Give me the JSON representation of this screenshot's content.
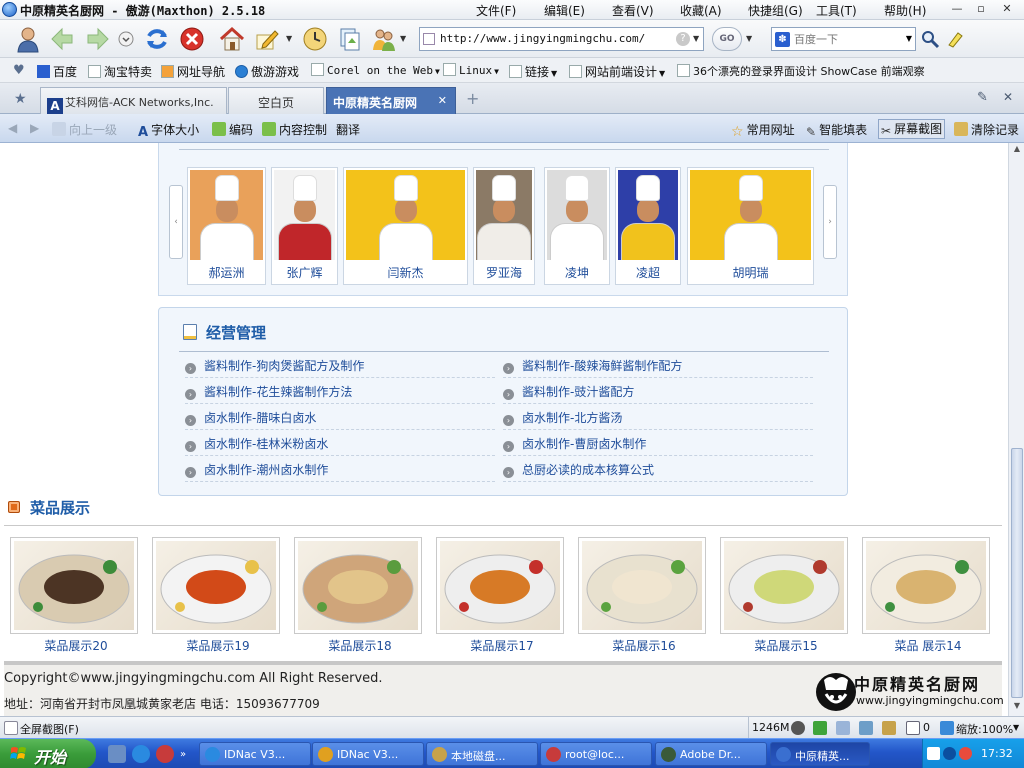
{
  "window": {
    "title": "中原精英名厨网 - 傲游(Maxthon) 2.5.18",
    "menu": [
      "文件(F)",
      "编辑(E)",
      "查看(V)",
      "收藏(A)",
      "快捷组(G)",
      "工具(T)",
      "帮助(H)"
    ]
  },
  "toolbar": {
    "address": "http://www.jingyingmingchu.com/",
    "go_label": "GO",
    "search_placeholder": "百度一下"
  },
  "favorites": [
    {
      "label": "百度",
      "dropdown": false
    },
    {
      "label": "淘宝特卖",
      "dropdown": false
    },
    {
      "label": "网址导航",
      "dropdown": false
    },
    {
      "label": "傲游游戏",
      "dropdown": false
    },
    {
      "label": "Corel on the Web",
      "dropdown": true
    },
    {
      "label": "Linux",
      "dropdown": true
    },
    {
      "label": "链接",
      "dropdown": true
    },
    {
      "label": "网站前端设计",
      "dropdown": true
    },
    {
      "label": "36个漂亮的登录界面设计 ShowCase 前端观察",
      "dropdown": false
    }
  ],
  "tabs": [
    {
      "label": "艾科网信-ACK Networks,Inc.",
      "active": false
    },
    {
      "label": "空白页",
      "active": false
    },
    {
      "label": "中原精英名厨网",
      "active": true
    }
  ],
  "subbar": {
    "up_label": "向上一级",
    "font_size": "字体大小",
    "encoding": "编码",
    "content_control": "内容控制",
    "translate": "翻译",
    "common_sites": "常用网址",
    "smart_fill": "智能填表",
    "screenshot": "屏幕截图",
    "clear_history": "清除记录"
  },
  "chefs": [
    {
      "name": "郝运洲",
      "bg": "#e9a15a",
      "body": "#ffffff"
    },
    {
      "name": "张广辉",
      "bg": "#f2f2f2",
      "body": "#c0262a"
    },
    {
      "name": "闫新杰",
      "bg": "#f3c21a",
      "body": "#ffffff"
    },
    {
      "name": "罗亚海",
      "bg": "#8b7a66",
      "body": "#f0ede8"
    },
    {
      "name": "凌坤",
      "bg": "#dcdcdc",
      "body": "#ffffff"
    },
    {
      "name": "凌超",
      "bg": "#2e3fa8",
      "body": "#f1c21c"
    },
    {
      "name": "胡明瑞",
      "bg": "#f3c21a",
      "body": "#ffffff"
    }
  ],
  "management": {
    "title": "经营管理",
    "articles": [
      "酱料制作-狗肉煲酱配方及制作",
      "酱料制作-酸辣海鲜酱制作配方",
      "酱料制作-花生辣酱制作方法",
      "酱料制作-豉汁酱配方",
      "卤水制作-腊味白卤水",
      "卤水制作-北方酱汤",
      "卤水制作-桂林米粉卤水",
      "卤水制作-曹厨卤水制作",
      "卤水制作-潮州卤水制作",
      "总厨必读的成本核算公式"
    ]
  },
  "dishes": {
    "title": "菜品展示",
    "items": [
      {
        "label": "菜品展示20",
        "plate": "#d9cbb1",
        "food": "#4c3424",
        "garnish": "#3d8c3a"
      },
      {
        "label": "菜品展示19",
        "plate": "#f3f3f3",
        "food": "#d24a18",
        "garnish": "#e8c14a"
      },
      {
        "label": "菜品展示18",
        "plate": "#cfa57a",
        "food": "#e2c48a",
        "garnish": "#5a9c3e"
      },
      {
        "label": "菜品展示17",
        "plate": "#eeeeee",
        "food": "#d77a26",
        "garnish": "#c4302b"
      },
      {
        "label": "菜品展示16",
        "plate": "#e8e1cf",
        "food": "#f0e5d0",
        "garnish": "#5aa33f"
      },
      {
        "label": "菜品展示15",
        "plate": "#eeeeee",
        "food": "#cfd879",
        "garnish": "#b03a2e"
      },
      {
        "label": "菜品 展示14",
        "plate": "#f2ece0",
        "food": "#d9b370",
        "garnish": "#3f9040"
      }
    ]
  },
  "footer": {
    "copyright": "Copyright©www.jingyingmingchu.com All Right Reserved.",
    "address": "地址：河南省开封市凤凰城黄家老店 电话：15093677709",
    "brand": "中原精英名厨网",
    "brand_url": "www.jingyingmingchu.com"
  },
  "statusbar": {
    "left": "全屏截图(F)",
    "memory": "1246M",
    "count": "0",
    "zoom": "缩放:100%"
  },
  "taskbar": {
    "start": "开始",
    "tasks": [
      "IDNac V3...",
      "IDNac V3...",
      "本地磁盘...",
      "root@loc...",
      "Adobe Dr...",
      "中原精英..."
    ],
    "clock": "17:32"
  },
  "colors": {
    "link": "#1f4d9a",
    "heading": "#1f5da8",
    "panel_bg": "#f1f6fc",
    "active_tab": "#4a73b5",
    "taskbar": "#2356c9"
  }
}
